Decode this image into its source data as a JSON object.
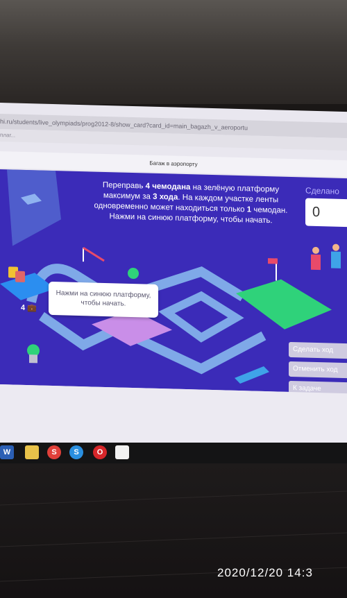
{
  "browser": {
    "url": "hi.ru/students/live_olympiads/prog2012-8/show_card?card_id=main_bagazh_v_aeroportu",
    "bookmark": "плаг..."
  },
  "page": {
    "title": "Багаж в аэропорту"
  },
  "game": {
    "instruction": {
      "line1_a": "Переправь ",
      "line1_b": "4 чемодана",
      "line1_c": " на зелёную платформу",
      "line2_a": "максимум за ",
      "line2_b": "3 хода",
      "line2_c": ". На каждом участке ленты",
      "line3_a": "одновременно может находиться только ",
      "line3_b": "1",
      "line3_c": " чемодан.",
      "line4": "Нажми на синюю платформу, чтобы начать."
    },
    "counter_label": "Сделано",
    "counter_value": "0",
    "tooltip": "Нажми на синюю платформу, чтобы начать.",
    "suitcase_count": "4",
    "buttons": {
      "make_move": "Сделать ход",
      "undo": "Отменить ход",
      "to_task": "К задаче"
    },
    "colors": {
      "background": "#3b2bb8",
      "belt": "#7fa9e8",
      "start_platform": "#2b8ef0",
      "finish_platform": "#2fd27a",
      "middle_platform": "#c98ee8"
    }
  },
  "taskbar": {
    "icons": [
      "word-icon",
      "folder-icon",
      "skype-icon",
      "skype-alt-icon",
      "opera-icon",
      "document-icon"
    ],
    "icon_labels": [
      "W",
      "",
      "S",
      "S",
      "O",
      ""
    ]
  },
  "photo": {
    "timestamp": "2020/12/20  14:3"
  }
}
